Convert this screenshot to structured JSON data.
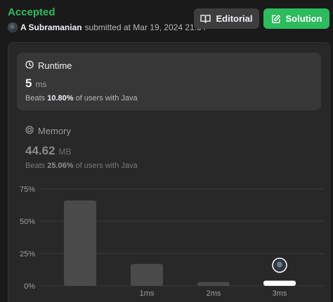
{
  "header": {
    "status": "Accepted",
    "submitter_name": "A Subramanian",
    "submitted_text": "submitted at Mar 19, 2024 21:34",
    "editorial_label": "Editorial",
    "solution_label": "Solution"
  },
  "runtime": {
    "label": "Runtime",
    "value": "5",
    "unit": "ms",
    "beats_prefix": "Beats",
    "beats_pct": "10.80%",
    "beats_suffix": "of users with Java"
  },
  "memory": {
    "label": "Memory",
    "value": "44.62",
    "unit": "MB",
    "beats_prefix": "Beats",
    "beats_pct": "25.06%",
    "beats_suffix": "of users with Java"
  },
  "colors": {
    "accent_green": "#2cbb5d",
    "bar": "#4a4a4a",
    "bar_highlight": "#ffffff"
  },
  "chart_data": {
    "type": "bar",
    "y_tick_labels": [
      "0%",
      "25%",
      "50%",
      "75%"
    ],
    "ylim": [
      0,
      75
    ],
    "categories": [
      "",
      "1ms",
      "2ms",
      "3ms"
    ],
    "values": [
      66,
      17,
      3,
      4
    ],
    "highlight_index": 3,
    "grid": true
  }
}
